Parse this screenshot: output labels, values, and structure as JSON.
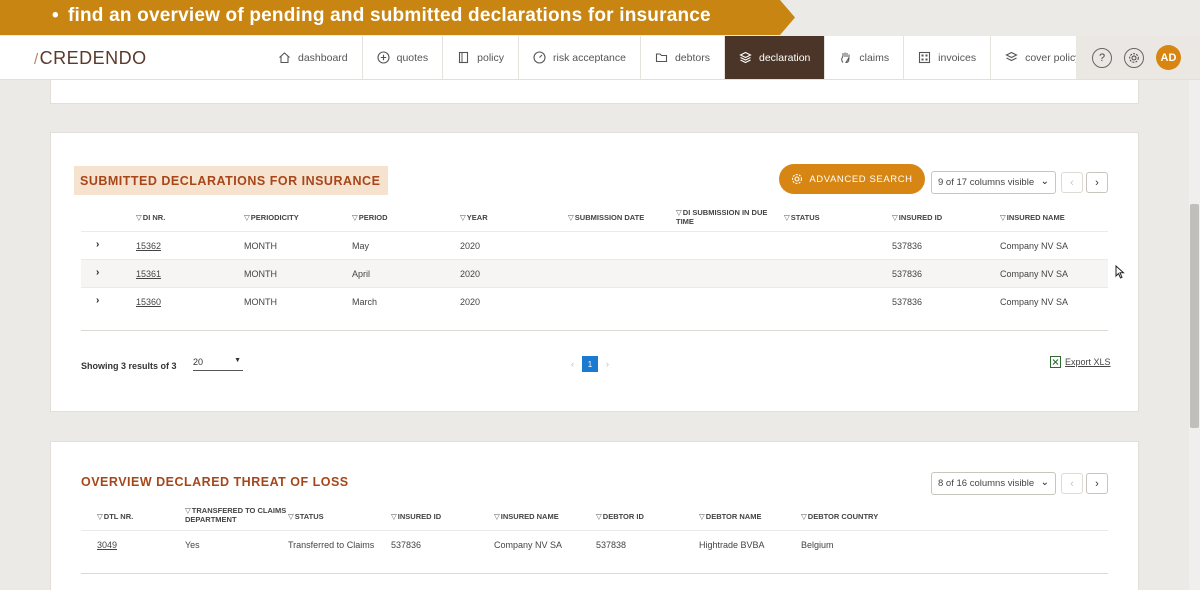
{
  "banner": {
    "bullet": "•",
    "text": "find an overview of pending and submitted declarations for insurance"
  },
  "brand": {
    "logo_mark": "/",
    "logo_text": "CREDENDO"
  },
  "nav": {
    "items": [
      {
        "label": "dashboard",
        "icon": "home-icon"
      },
      {
        "label": "quotes",
        "icon": "plus-circle-icon"
      },
      {
        "label": "policy",
        "icon": "document-icon"
      },
      {
        "label": "risk acceptance",
        "icon": "gauge-icon"
      },
      {
        "label": "debtors",
        "icon": "folder-icon"
      },
      {
        "label": "declaration",
        "icon": "layers-icon",
        "active": true
      },
      {
        "label": "claims",
        "icon": "hand-icon"
      },
      {
        "label": "invoices",
        "icon": "grid-icon"
      },
      {
        "label": "cover policy",
        "icon": "stack-icon"
      }
    ],
    "help": "?",
    "avatar": "AD"
  },
  "submitted": {
    "title": "SUBMITTED DECLARATIONS FOR INSURANCE",
    "advanced_search": "ADVANCED SEARCH",
    "columns_visible": "9 of 17 columns visible",
    "headers": [
      "DI NR.",
      "PERIODICITY",
      "PERIOD",
      "YEAR",
      "SUBMISSION DATE",
      "DI SUBMISSION IN DUE TIME",
      "STATUS",
      "INSURED ID",
      "INSURED NAME"
    ],
    "rows": [
      {
        "di_nr": "15362",
        "periodicity": "MONTH",
        "period": "May",
        "year": "2020",
        "submission_date": "",
        "due_time": "",
        "status": "",
        "insured_id": "537836",
        "insured_name": "Company NV SA"
      },
      {
        "di_nr": "15361",
        "periodicity": "MONTH",
        "period": "April",
        "year": "2020",
        "submission_date": "",
        "due_time": "",
        "status": "",
        "insured_id": "537836",
        "insured_name": "Company NV SA"
      },
      {
        "di_nr": "15360",
        "periodicity": "MONTH",
        "period": "March",
        "year": "2020",
        "submission_date": "",
        "due_time": "",
        "status": "",
        "insured_id": "537836",
        "insured_name": "Company NV SA"
      }
    ],
    "showing": "Showing 3 results of 3",
    "page_size": "20",
    "current_page": "1",
    "prev": "‹",
    "next": "›",
    "export": "Export XLS"
  },
  "threat": {
    "title": "OVERVIEW DECLARED THREAT OF LOSS",
    "columns_visible": "8 of 16 columns visible",
    "headers": [
      "DTL NR.",
      "TRANSFERED TO CLAIMS DEPARTMENT",
      "STATUS",
      "INSURED ID",
      "INSURED NAME",
      "DEBTOR ID",
      "DEBTOR NAME",
      "DEBTOR COUNTRY"
    ],
    "rows": [
      {
        "dtl_nr": "3049",
        "transfered": "Yes",
        "status": "Transferred to Claims",
        "insured_id": "537836",
        "insured_name": "Company NV SA",
        "debtor_id": "537838",
        "debtor_name": "Hightrade BVBA",
        "debtor_country": "Belgium"
      }
    ]
  },
  "colors": {
    "accent": "#d78614",
    "nav_active": "#4b3528",
    "title": "#a7461a",
    "highlight": "#f6e3cf",
    "page_active": "#1a79d0"
  }
}
